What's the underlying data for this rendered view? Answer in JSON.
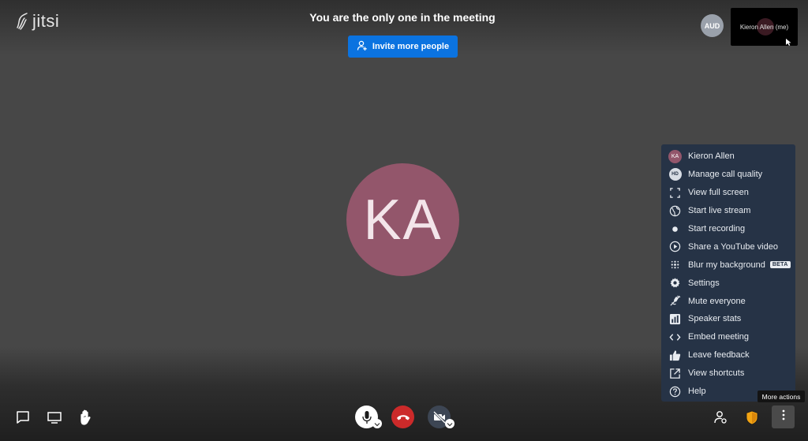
{
  "logo": {
    "text": "jitsi"
  },
  "header": {
    "message": "You are the only one in the meeting",
    "invite_label": "Invite more people"
  },
  "participants": {
    "audio_badge": "AUD",
    "self_name": "Kieron Allen (me)",
    "main_initials": "KA"
  },
  "menu": {
    "items": [
      {
        "label": "Kieron Allen",
        "icon": "avatar-icon",
        "avatar_text": "KA"
      },
      {
        "label": "Manage call quality",
        "icon": "hd-icon",
        "badge_text": "HD"
      },
      {
        "label": "View full screen",
        "icon": "fullscreen-icon"
      },
      {
        "label": "Start live stream",
        "icon": "globe-icon"
      },
      {
        "label": "Start recording",
        "icon": "record-icon"
      },
      {
        "label": "Share a YouTube video",
        "icon": "play-icon"
      },
      {
        "label": "Blur my background",
        "icon": "blur-icon",
        "tag": "BETA"
      },
      {
        "label": "Settings",
        "icon": "gear-icon"
      },
      {
        "label": "Mute everyone",
        "icon": "mute-everyone-icon"
      },
      {
        "label": "Speaker stats",
        "icon": "stats-icon"
      },
      {
        "label": "Embed meeting",
        "icon": "code-icon"
      },
      {
        "label": "Leave feedback",
        "icon": "thumbs-up-icon"
      },
      {
        "label": "View shortcuts",
        "icon": "external-link-icon"
      },
      {
        "label": "Help",
        "icon": "help-icon"
      }
    ]
  },
  "tooltip": {
    "text": "More actions"
  },
  "colors": {
    "accent": "#0b73e0",
    "hangup": "#cc2a2a",
    "avatar": "#93566b",
    "menu_bg": "#263346",
    "security": "#f2a413"
  },
  "toolbar": {
    "left": [
      "chat-icon",
      "screen-share-icon",
      "raise-hand-icon"
    ],
    "center": [
      "microphone-icon",
      "hangup-icon",
      "camera-off-icon"
    ],
    "right": [
      "invite-icon",
      "security-shield-icon",
      "more-actions-icon"
    ]
  }
}
